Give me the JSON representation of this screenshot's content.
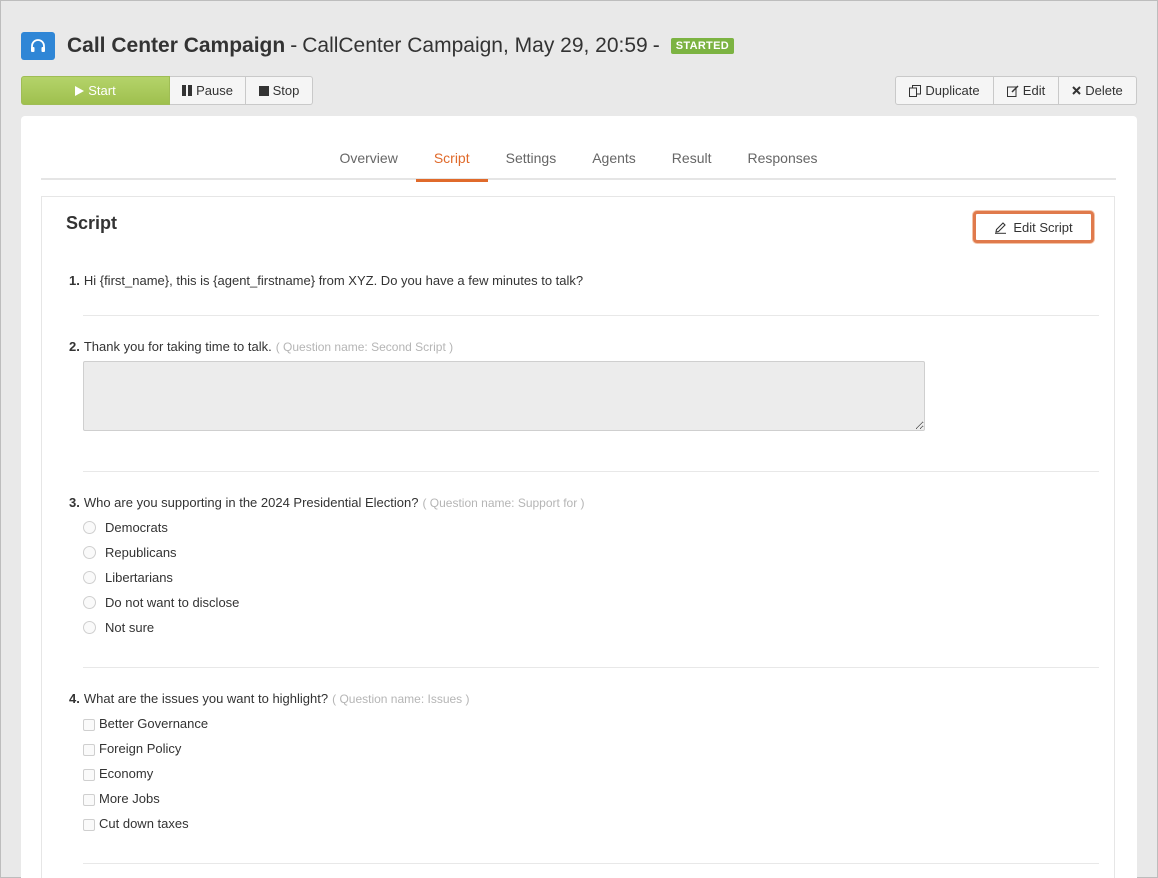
{
  "header": {
    "title": "Call Center Campaign",
    "separator": "-",
    "subtitle": "CallCenter Campaign, May 29, 20:59",
    "separator2": "-",
    "status": "STARTED",
    "icon": "headset-icon"
  },
  "toolbar": {
    "start_label": "Start",
    "pause_label": "Pause",
    "stop_label": "Stop",
    "duplicate_label": "Duplicate",
    "edit_label": "Edit",
    "delete_label": "Delete"
  },
  "tabs": [
    {
      "label": "Overview",
      "active": false
    },
    {
      "label": "Script",
      "active": true
    },
    {
      "label": "Settings",
      "active": false
    },
    {
      "label": "Agents",
      "active": false
    },
    {
      "label": "Result",
      "active": false
    },
    {
      "label": "Responses",
      "active": false
    }
  ],
  "script": {
    "title": "Script",
    "edit_label": "Edit Script",
    "questions": [
      {
        "num": "1.",
        "text": "Hi {first_name}, this is {agent_firstname} from XYZ. Do you have a few minutes to talk?",
        "qname": ""
      },
      {
        "num": "2.",
        "text": "Thank you for taking time to talk.",
        "qname": "( Question name: Second Script )",
        "textarea_value": ""
      },
      {
        "num": "3.",
        "text": "Who are you supporting in the 2024 Presidential Election?",
        "qname": "( Question name: Support for )",
        "options": [
          "Democrats",
          "Republicans",
          "Libertarians",
          "Do not want to disclose",
          "Not sure"
        ]
      },
      {
        "num": "4.",
        "text": "What are the issues you want to highlight?",
        "qname": "( Question name: Issues )",
        "options": [
          "Better Governance",
          "Foreign Policy",
          "Economy",
          "More Jobs",
          "Cut down taxes"
        ]
      }
    ]
  },
  "colors": {
    "accent": "#e06a2b",
    "start": "#a7c957",
    "badge": "#7cb342",
    "app_icon": "#2f86d6"
  }
}
